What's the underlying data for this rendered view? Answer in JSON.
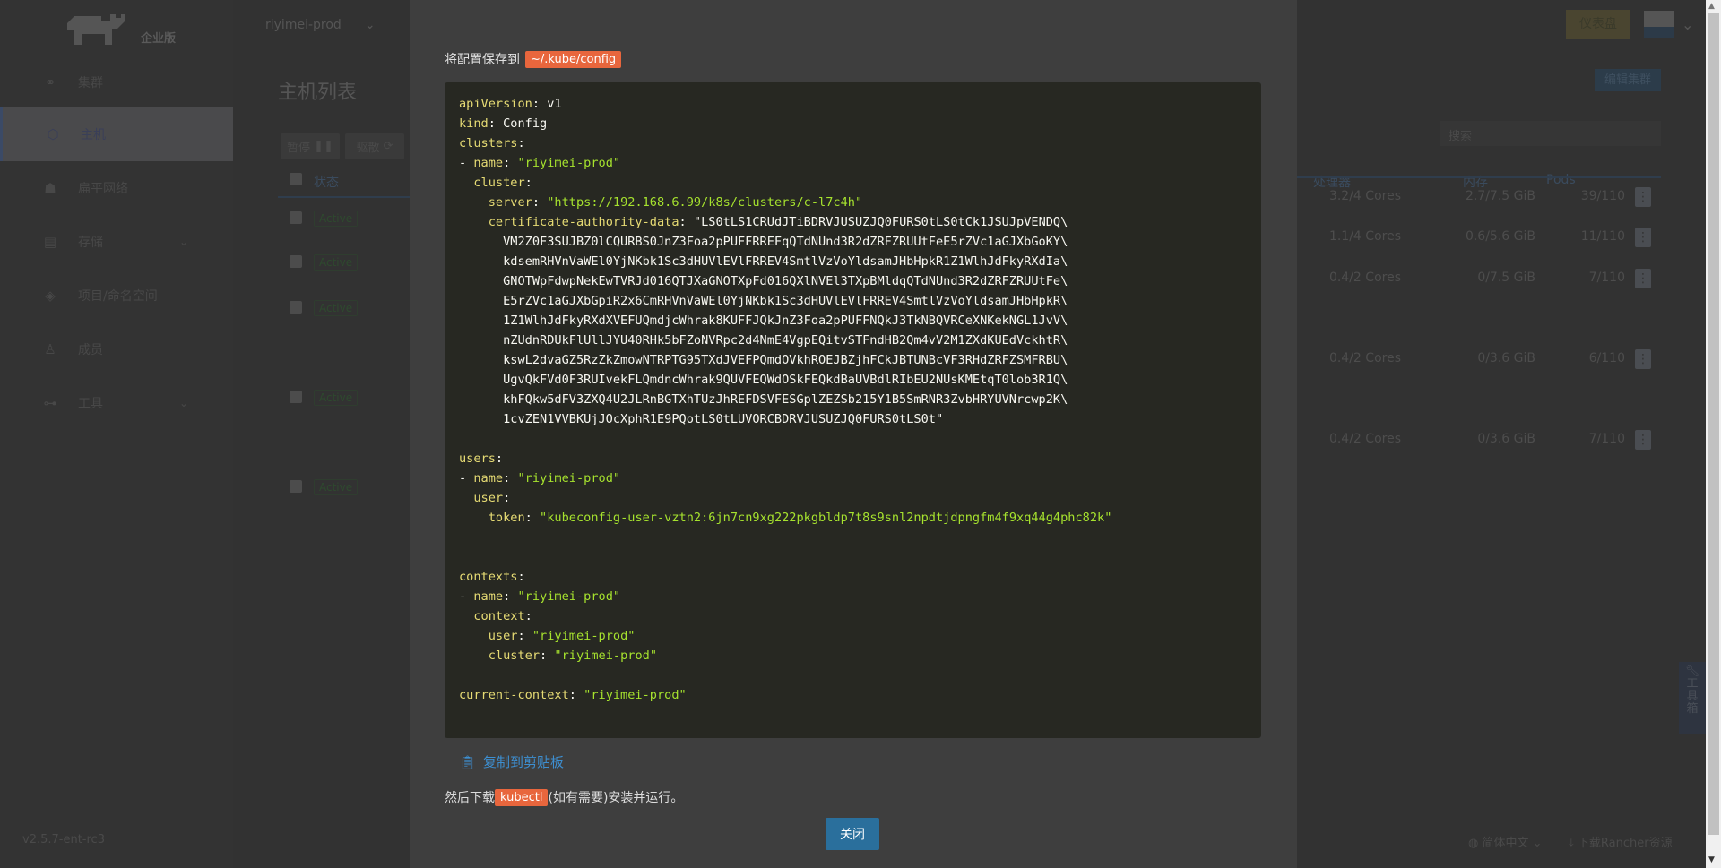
{
  "header": {
    "brand_sub": "企业版",
    "cluster": "riyimei-prod",
    "dashboard_button": "仪表盘"
  },
  "sidebar": {
    "items": [
      {
        "label": "集群",
        "icon": "cluster-icon"
      },
      {
        "label": "主机",
        "icon": "host-icon",
        "selected": true
      },
      {
        "label": "扁平网络",
        "icon": "network-icon"
      },
      {
        "label": "存储",
        "icon": "storage-icon",
        "expandable": true
      },
      {
        "label": "项目/命名空间",
        "icon": "layers-icon"
      },
      {
        "label": "成员",
        "icon": "members-icon"
      },
      {
        "label": "工具",
        "icon": "tools-icon",
        "expandable": true
      }
    ],
    "version": "v2.5.7-ent-rc3"
  },
  "main": {
    "title": "主机列表",
    "pause_button": "暂停",
    "drain_button": "驱散",
    "edit_cluster_button": "编辑集群",
    "search_placeholder": "搜索",
    "columns": {
      "state": "状态",
      "cpu": "处理器",
      "memory": "内存",
      "pods": "Pods"
    },
    "rows": [
      {
        "state": "Active",
        "cpu": "3.2/4 Cores",
        "memory": "2.7/7.5 GiB",
        "pods": "39/110"
      },
      {
        "state": "Active",
        "cpu": "1.1/4 Cores",
        "memory": "0.6/5.6 GiB",
        "pods": "11/110"
      },
      {
        "state": "Active",
        "cpu": "0.4/2 Cores",
        "memory": "0/7.5 GiB",
        "pods": "7/110"
      },
      {
        "state": "Active",
        "cpu": "0.4/2 Cores",
        "memory": "0/3.6 GiB",
        "pods": "6/110"
      },
      {
        "state": "Active",
        "cpu": "0.4/2 Cores",
        "memory": "0/3.6 GiB",
        "pods": "7/110"
      }
    ]
  },
  "footer": {
    "language": "简体中文",
    "download": "下载Rancher资源",
    "toolbox": "工具箱"
  },
  "modal": {
    "save_prefix": "将配置保存到",
    "save_path": "~/.kube/config",
    "copy_label": "复制到剪贴板",
    "then_prefix": "然后下载",
    "kubectl": "kubectl",
    "then_suffix": "(如有需要)安装并运行。",
    "close_button": "关闭",
    "code_lines": [
      [
        [
          "k",
          "apiVersion"
        ],
        [
          "p",
          ": v1"
        ]
      ],
      [
        [
          "k",
          "kind"
        ],
        [
          "p",
          ": Config"
        ]
      ],
      [
        [
          "k",
          "clusters"
        ],
        [
          "p",
          ":"
        ]
      ],
      [
        [
          "p",
          "- "
        ],
        [
          "k",
          "name"
        ],
        [
          "p",
          ": "
        ],
        [
          "s",
          "\"riyimei-prod\""
        ]
      ],
      [
        [
          "p",
          "  "
        ],
        [
          "k",
          "cluster"
        ],
        [
          "p",
          ":"
        ]
      ],
      [
        [
          "p",
          "    "
        ],
        [
          "k",
          "server"
        ],
        [
          "p",
          ": "
        ],
        [
          "s",
          "\"https://192.168.6.99/k8s/clusters/c-l7c4h\""
        ]
      ],
      [
        [
          "p",
          "    "
        ],
        [
          "k",
          "certificate-authority-data"
        ],
        [
          "p",
          ": \"LS0tLS1CRUdJTiBDRVJUSUZJQ0FURS0tLS0tCk1JSUJpVENDQ\\"
        ]
      ],
      [
        [
          "p",
          "      VM2Z0F3SUJBZ0lCQURBS0JnZ3Foa2pPUFFRREFqQTdNUnd3R2dZRFZRUUtFeE5rZVc1aGJXbGoKY\\"
        ]
      ],
      [
        [
          "p",
          "      kdsemRHVnVaWEl0YjNKbk1Sc3dHUVlEVlFRREV4SmtlVzVoYldsamJHbHpkR1Z1WlhJdFkyRXdIa\\"
        ]
      ],
      [
        [
          "p",
          "      GNOTWpFdwpNekEwTVRJd016QTJXaGNOTXpFd016QXlNVEl3TXpBMldqQTdNUnd3R2dZRFZRUUtFe\\"
        ]
      ],
      [
        [
          "p",
          "      E5rZVc1aGJXbGpiR2x6CmRHVnVaWEl0YjNKbk1Sc3dHUVlEVlFRREV4SmtlVzVoYldsamJHbHpkR\\"
        ]
      ],
      [
        [
          "p",
          "      1Z1WlhJdFkyRXdXVEFUQmdjcWhrak8KUFFJQkJnZ3Foa2pPUFFNQkJ3TkNBQVRCeXNKekNGL1JvV\\"
        ]
      ],
      [
        [
          "p",
          "      nZUdnRDUkFlUllJYU40RHk5bFZoNVRpc2d4NmE4VgpEQitvSTFndHB2Qm4vV2M1ZXdKUEdVckhtR\\"
        ]
      ],
      [
        [
          "p",
          "      kswL2dvaGZ5RzZkZmowNTRPTG95TXdJVEFPQmdOVkhROEJBZjhFCkJBTUNBcVF3RHdZRFZSMFRBU\\"
        ]
      ],
      [
        [
          "p",
          "      UgvQkFVd0F3RUIvekFLQmdncWhrak9QUVFEQWdOSkFEQkdBaUVBdlRIbEU2NUsKMEtqT0lob3R1Q\\"
        ]
      ],
      [
        [
          "p",
          "      khFQkw5dFV3ZXQ4U2JLRnBGTXhTUzJhREFDSVFESGplZEZSb215Y1B5SmRNR3ZvbHRYUVNrcwp2K\\"
        ]
      ],
      [
        [
          "p",
          "      1cvZEN1VVBKUjJOcXphR1E9PQotLS0tLUVORCBDRVJUSUZJQ0FURS0tLS0t\""
        ]
      ],
      [],
      [
        [
          "k",
          "users"
        ],
        [
          "p",
          ":"
        ]
      ],
      [
        [
          "p",
          "- "
        ],
        [
          "k",
          "name"
        ],
        [
          "p",
          ": "
        ],
        [
          "s",
          "\"riyimei-prod\""
        ]
      ],
      [
        [
          "p",
          "  "
        ],
        [
          "k",
          "user"
        ],
        [
          "p",
          ":"
        ]
      ],
      [
        [
          "p",
          "    "
        ],
        [
          "k",
          "token"
        ],
        [
          "p",
          ": "
        ],
        [
          "s",
          "\"kubeconfig-user-vztn2:6jn7cn9xg222pkgbldp7t8s9snl2npdtjdpngfm4f9xq44g4phc82k\""
        ]
      ],
      [],
      [],
      [
        [
          "k",
          "contexts"
        ],
        [
          "p",
          ":"
        ]
      ],
      [
        [
          "p",
          "- "
        ],
        [
          "k",
          "name"
        ],
        [
          "p",
          ": "
        ],
        [
          "s",
          "\"riyimei-prod\""
        ]
      ],
      [
        [
          "p",
          "  "
        ],
        [
          "k",
          "context"
        ],
        [
          "p",
          ":"
        ]
      ],
      [
        [
          "p",
          "    "
        ],
        [
          "k",
          "user"
        ],
        [
          "p",
          ": "
        ],
        [
          "s",
          "\"riyimei-prod\""
        ]
      ],
      [
        [
          "p",
          "    "
        ],
        [
          "k",
          "cluster"
        ],
        [
          "p",
          ": "
        ],
        [
          "s",
          "\"riyimei-prod\""
        ]
      ],
      [],
      [
        [
          "k",
          "current-context"
        ],
        [
          "p",
          ": "
        ],
        [
          "s",
          "\"riyimei-prod\""
        ]
      ]
    ]
  },
  "colors": {
    "accent_orange": "#e8663d",
    "primary_blue": "#2a6f9c",
    "code_bg": "#272822",
    "code_key": "#e6db74",
    "code_string": "#a6e22e"
  }
}
